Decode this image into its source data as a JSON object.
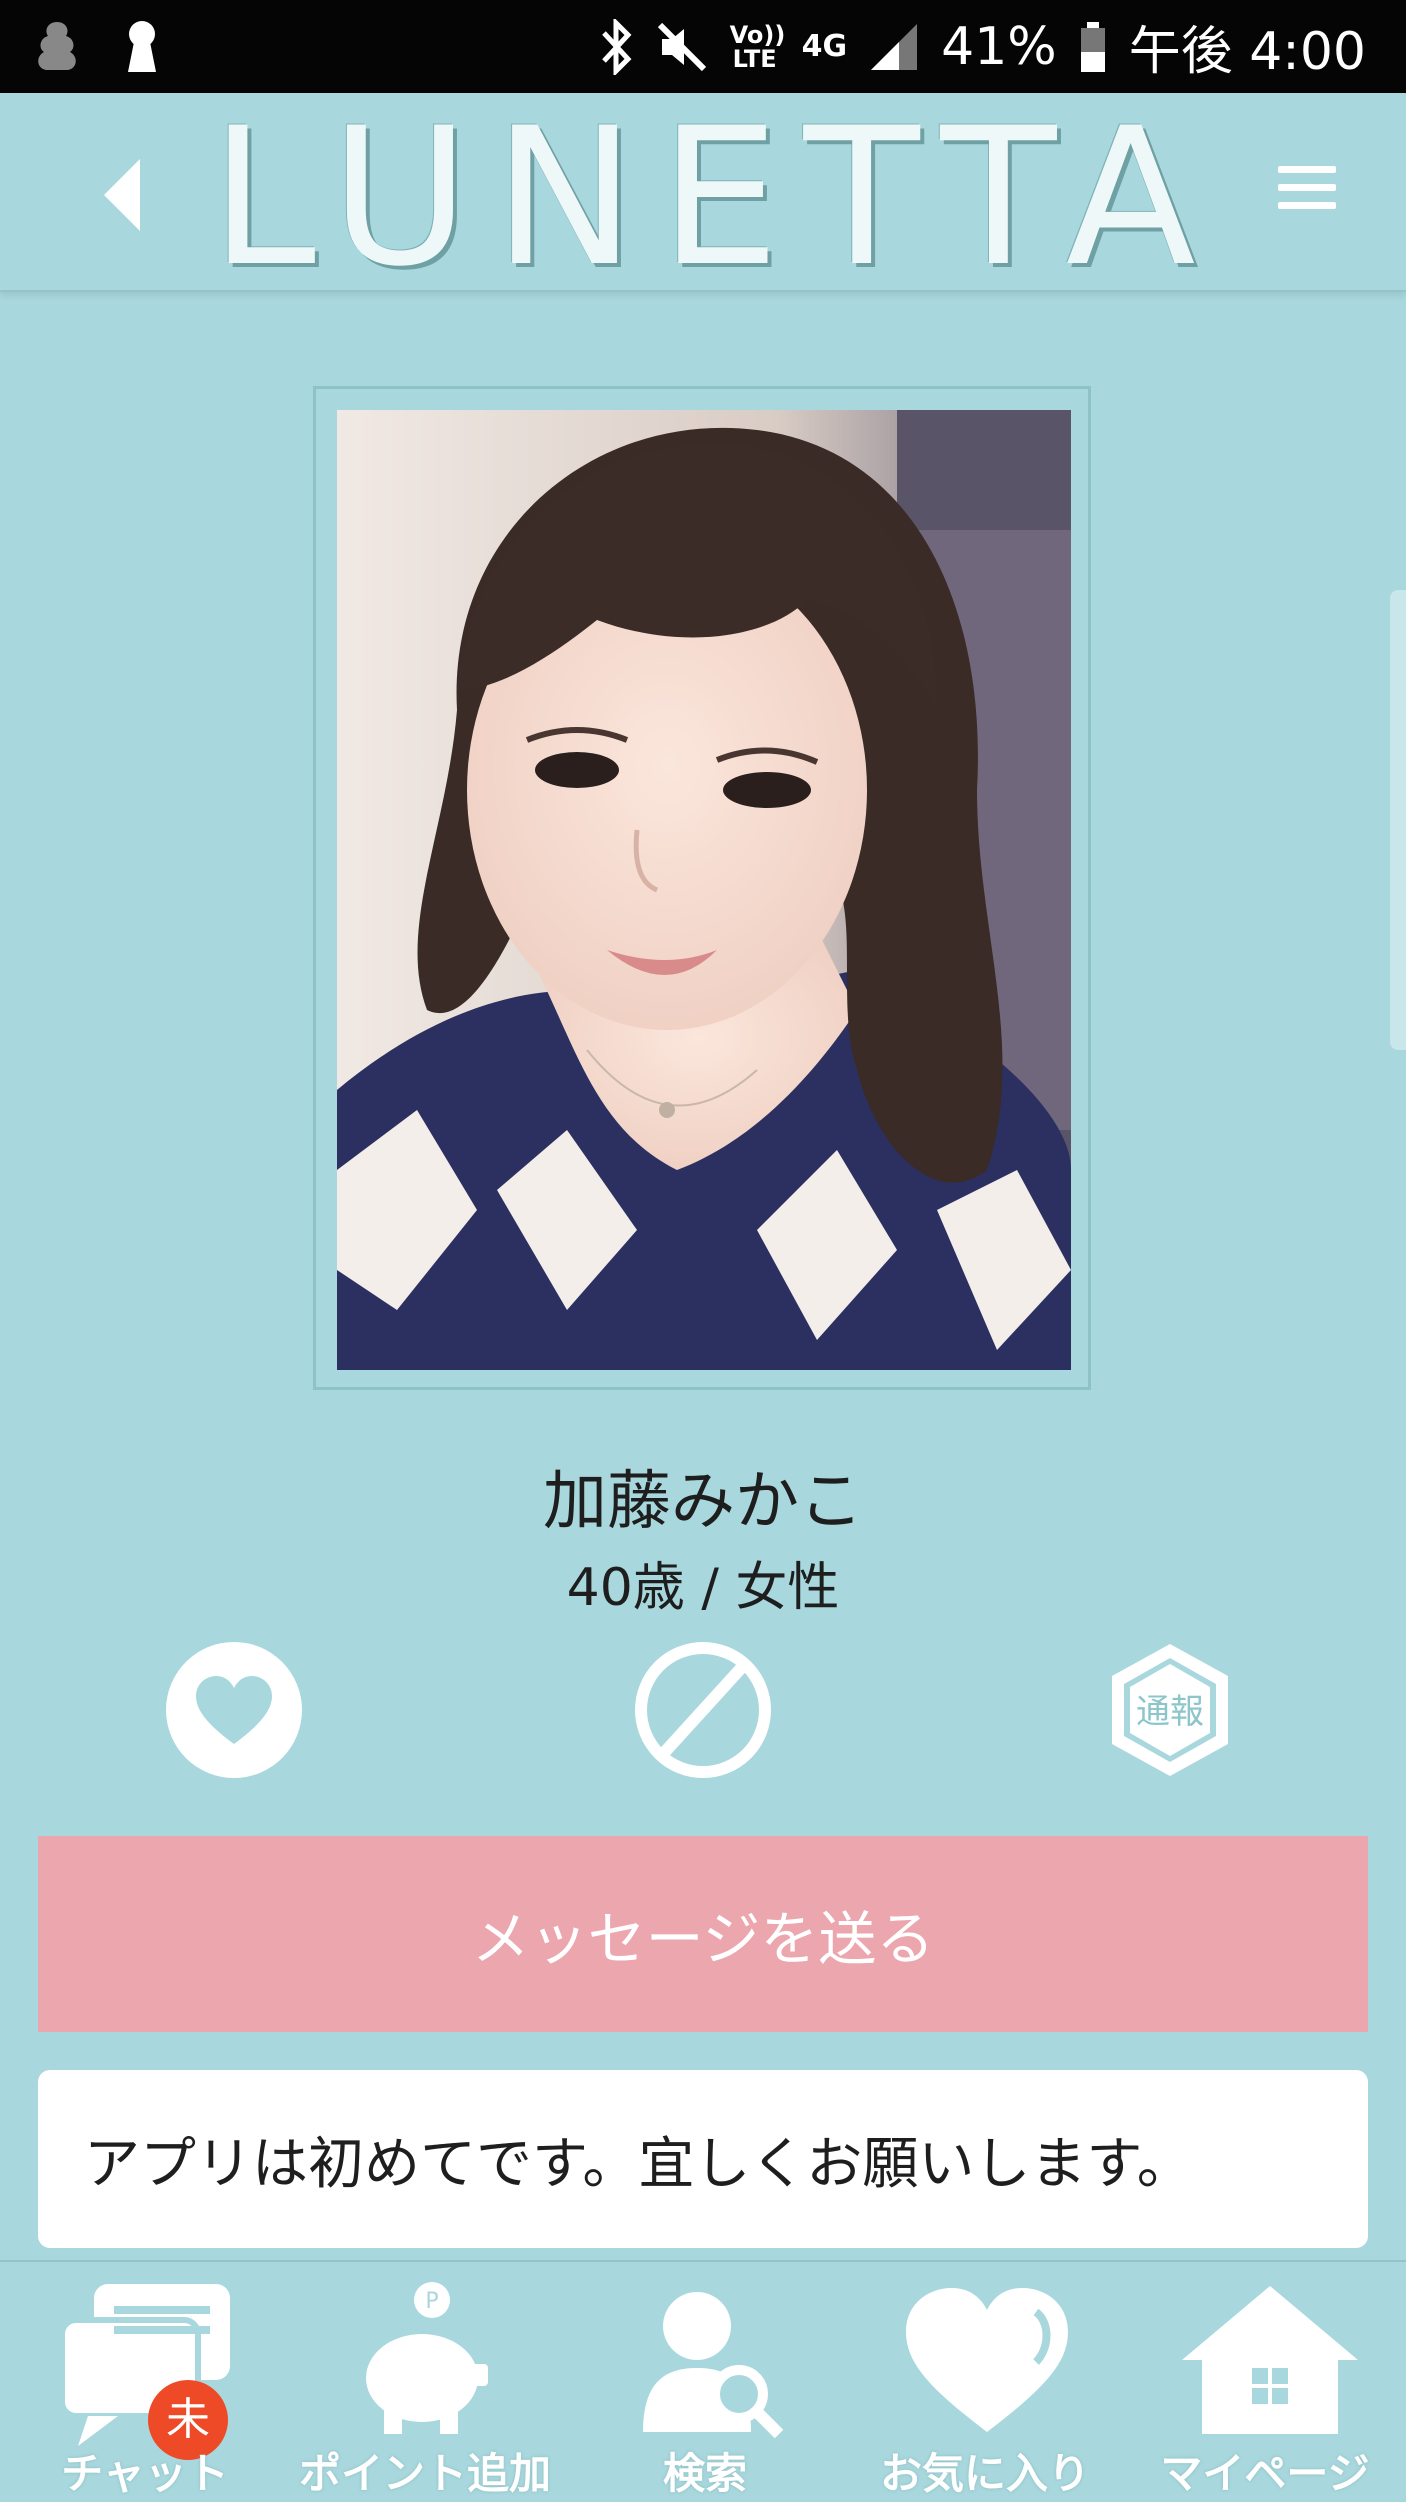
{
  "status_bar": {
    "volte": "Vo)) LTE",
    "network": "4G",
    "battery": "41%",
    "time": "午後 4:00"
  },
  "header": {
    "logo": "LUNETTA"
  },
  "profile": {
    "name": "加藤みかこ",
    "age_gender": "40歳 / 女性",
    "report_label": "通報",
    "message_button": "メッセージを送る",
    "intro": "アプリは初めてです。宜しくお願いします。"
  },
  "bottom_nav": {
    "chat": "チャット",
    "chat_badge": "未",
    "points": "ポイント追加",
    "search": "検索",
    "favorites": "お気に入り",
    "mypage": "マイページ"
  },
  "colors": {
    "background": "#a8d8dd",
    "message_button": "#eba6ae",
    "badge": "#ee4a28"
  }
}
